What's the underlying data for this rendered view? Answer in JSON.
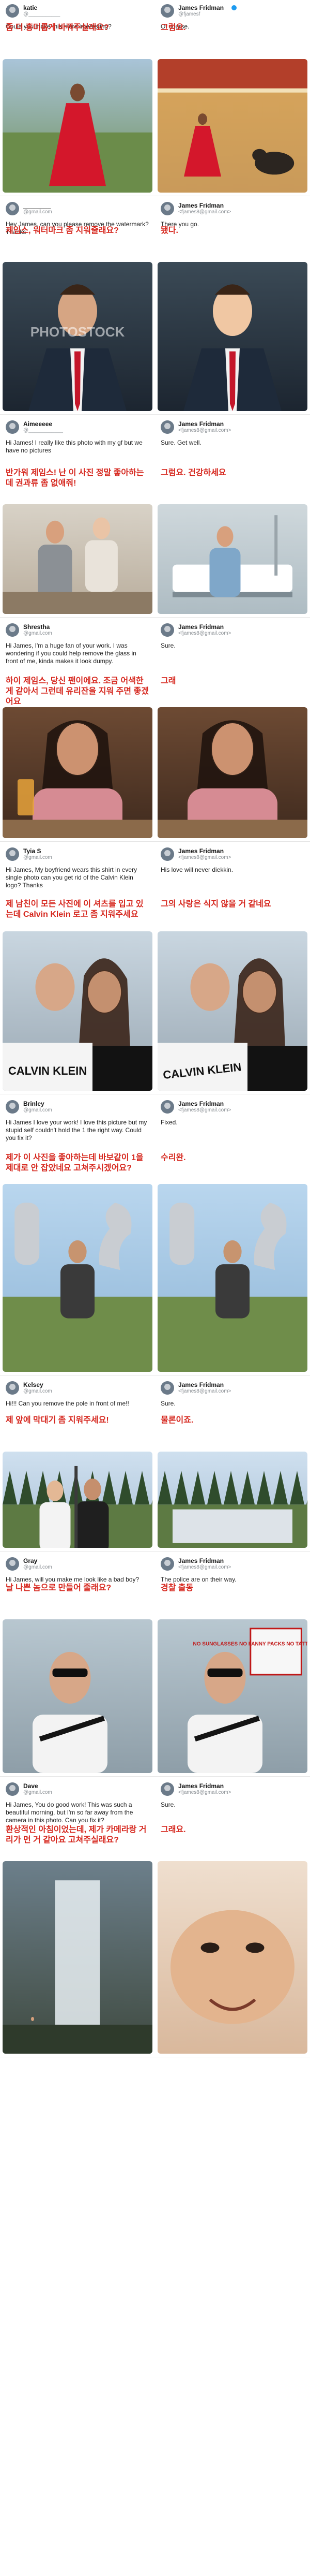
{
  "colors": {
    "korean_caption": "#d6281f",
    "handle_gray": "#8a8f94",
    "verified_blue": "#1d9bf0"
  },
  "panels": [
    {
      "left": {
        "name": "katie",
        "handle": "@___________",
        "en": "Could you make this more interesting?",
        "ko": "좀 더 흥미롭게 바꿔주실래요?",
        "photo": "woman-red-dress-park"
      },
      "right": {
        "name": "James Fridman",
        "handle": "@fjamesf",
        "en": "Of course.",
        "ko": "그럼요.",
        "photo": "bullfight-arena"
      }
    },
    {
      "left": {
        "name": "________",
        "handle": "@gmail.com",
        "en": "Hey James, can you please remove the watermark? Thanks",
        "ko": "제임스, 워터마크 좀 지워줄래요?",
        "photo": "man-suit-watermark"
      },
      "right": {
        "name": "James Fridman",
        "handle": "<fjames8@gmail.com>",
        "en": "There you go.",
        "ko": "됐다.",
        "photo": "man-suit-cartoon-face"
      }
    },
    {
      "left": {
        "name": "Aimeeeee",
        "handle": "@____________",
        "en": "Hi James! I really like this photo with my gf but we have no pictures",
        "ko": "반가워 제임스! 난 이 사진 정말 좋아하는데 권과류 좀 없애줘!",
        "photo": "couple-couch"
      },
      "right": {
        "name": "James Fridman",
        "handle": "<fjames8@gmail.com>",
        "en": "Sure. Get well.",
        "ko": "그럼요. 건강하세요",
        "photo": "hospital-bed"
      }
    },
    {
      "left": {
        "name": "Shrestha",
        "handle": "@gmail.com",
        "en": "Hi James, I'm a huge fan of your work. I was wondering if you could help remove the glass in front of me, kinda makes it look dumpy.",
        "ko": "하이 제임스, 당신 팬이에요. 조금 어색한게 같아서 그런데 유리잔을 지워 주면 좋겠어요",
        "photo": "woman-drink-table"
      },
      "right": {
        "name": "James Fridman",
        "handle": "<fjames8@gmail.com>",
        "en": "Sure.",
        "ko": "그래",
        "photo": "woman-no-glass"
      }
    },
    {
      "left": {
        "name": "Tyia S",
        "handle": "@gmail.com",
        "en": "Hi James, My boyfriend wears this shirt in every single photo can you get rid of the Calvin Klein logo? Thanks",
        "ko": "제 남친이 모든 사진에 이 셔츠를 입고 있는데 Calvin Klein 로고 좀 지워주세요",
        "photo": "couple-selfie-ck"
      },
      "right": {
        "name": "James Fridman",
        "handle": "<fjames8@gmail.com>",
        "en": "His love will never diekkin.",
        "ko": "그의 사랑은 식지 않을 거 같네요",
        "photo": "couple-selfie-ck-edit"
      }
    },
    {
      "left": {
        "name": "Brinley",
        "handle": "@gmail.com",
        "en": "Hi James I love your work! I love this picture but my stupid self couldn't hold the 1 the right way. Could you fix it?",
        "ko": "제가 이 사진을 좋아하는데 바보같이 1을 제대로 안 잡았네요 고쳐주시겠어요?",
        "photo": "girl-balloons-21"
      },
      "right": {
        "name": "James Fridman",
        "handle": "<fjames8@gmail.com>",
        "en": "Fixed.",
        "ko": "수리완.",
        "photo": "girl-balloons-fixed"
      }
    },
    {
      "left": {
        "name": "Kelsey",
        "handle": "@gmail.com",
        "en": "Hi!!! Can you remove the pole in front of me!!",
        "ko": "제 앞에 막대기 좀 지워주세요!",
        "photo": "couple-field-pole"
      },
      "right": {
        "name": "James Fridman",
        "handle": "<fjames8@gmail.com>",
        "en": "Sure.",
        "ko": "물론이죠.",
        "photo": "field-no-couple"
      }
    },
    {
      "left": {
        "name": "Gray",
        "handle": "@gmail.com",
        "en": "Hi James, will you make me look like a bad boy?",
        "ko": "날 나쁜 놈으로 만들어 줄래요?",
        "photo": "man-sunglasses"
      },
      "right": {
        "name": "James Fridman",
        "handle": "<fjames8@gmail.com>",
        "en": "The police are on their way.",
        "ko": "경찰 출동",
        "photo": "man-no-sunglasses-sign",
        "sign_text": "NO SUNGLASSES NO FANNY PACKS NO TATTOOS NO MUSTACHE"
      }
    },
    {
      "left": {
        "name": "Dave",
        "handle": "@gmail.com",
        "en": "Hi James, You do good work! This was such a beautiful morning, but I'm so far away from the camera in this photo. Can you fix it?",
        "ko": "환상적인 아침이었는데, 제가 카메라랑 거리가 먼 거 같아요 고쳐주실래요?",
        "photo": "waterfall-far"
      },
      "right": {
        "name": "James Fridman",
        "handle": "<fjames8@gmail.com>",
        "en": "Sure.",
        "ko": "그래요.",
        "photo": "face-closeup"
      }
    }
  ]
}
